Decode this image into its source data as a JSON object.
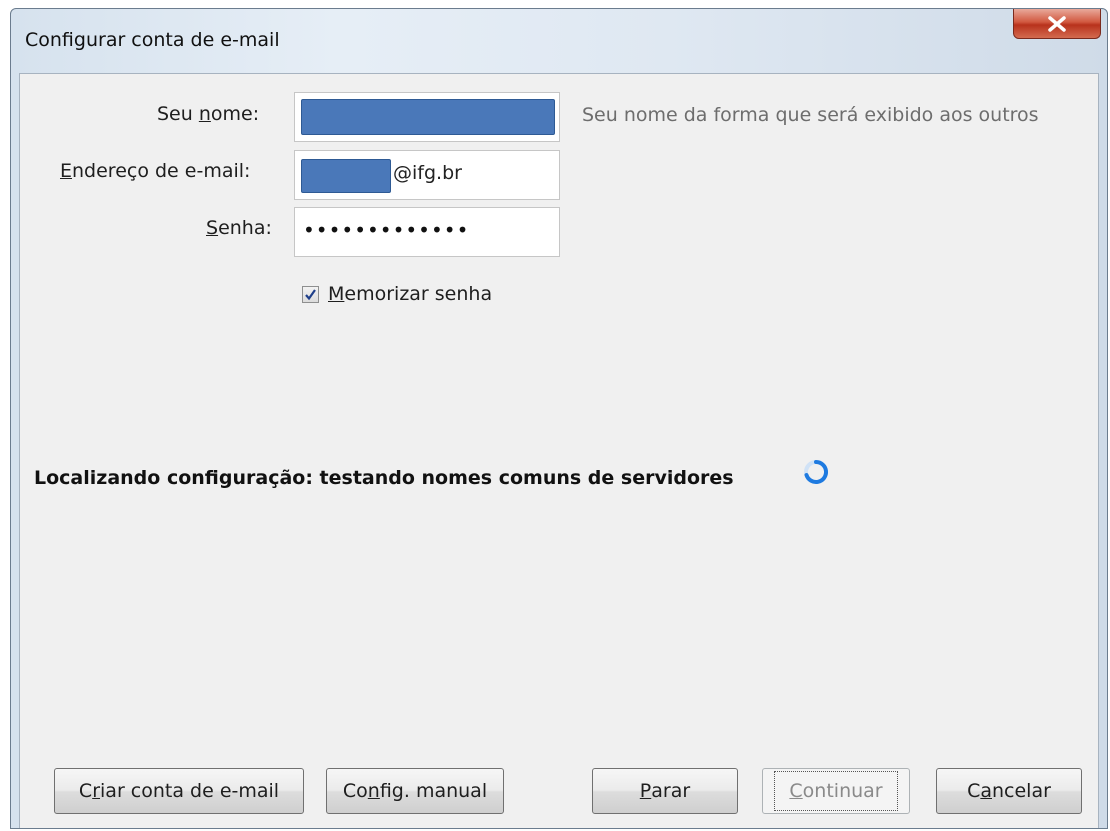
{
  "window": {
    "title": "Configurar conta de e-mail"
  },
  "form": {
    "name_label_pre": "Seu ",
    "name_label_accel": "n",
    "name_label_post": "ome:",
    "name_hint": "Seu nome da forma que será exibido aos outros",
    "email_label_accel": "E",
    "email_label_post": "ndereço de e-mail:",
    "email_suffix": "@ifg.br",
    "password_label_accel": "S",
    "password_label_post": "enha:",
    "password_masked": "•••••••••••••",
    "remember_accel": "M",
    "remember_post": "emorizar senha",
    "remember_checked": true
  },
  "status": {
    "text": "Localizando configuração: testando nomes comuns de servidores"
  },
  "buttons": {
    "create_pre": "C",
    "create_accel": "r",
    "create_post": "iar conta de e-mail",
    "manual_pre": "Co",
    "manual_accel": "n",
    "manual_post": "fig. manual",
    "stop_accel": "P",
    "stop_post": "arar",
    "continue_accel": "C",
    "continue_post": "ontinuar",
    "cancel_pre": "C",
    "cancel_accel": "a",
    "cancel_post": "ncelar"
  },
  "colors": {
    "redaction": "#4a78b9",
    "close_button": "#c9452c",
    "spinner": "#1e7ae0"
  }
}
